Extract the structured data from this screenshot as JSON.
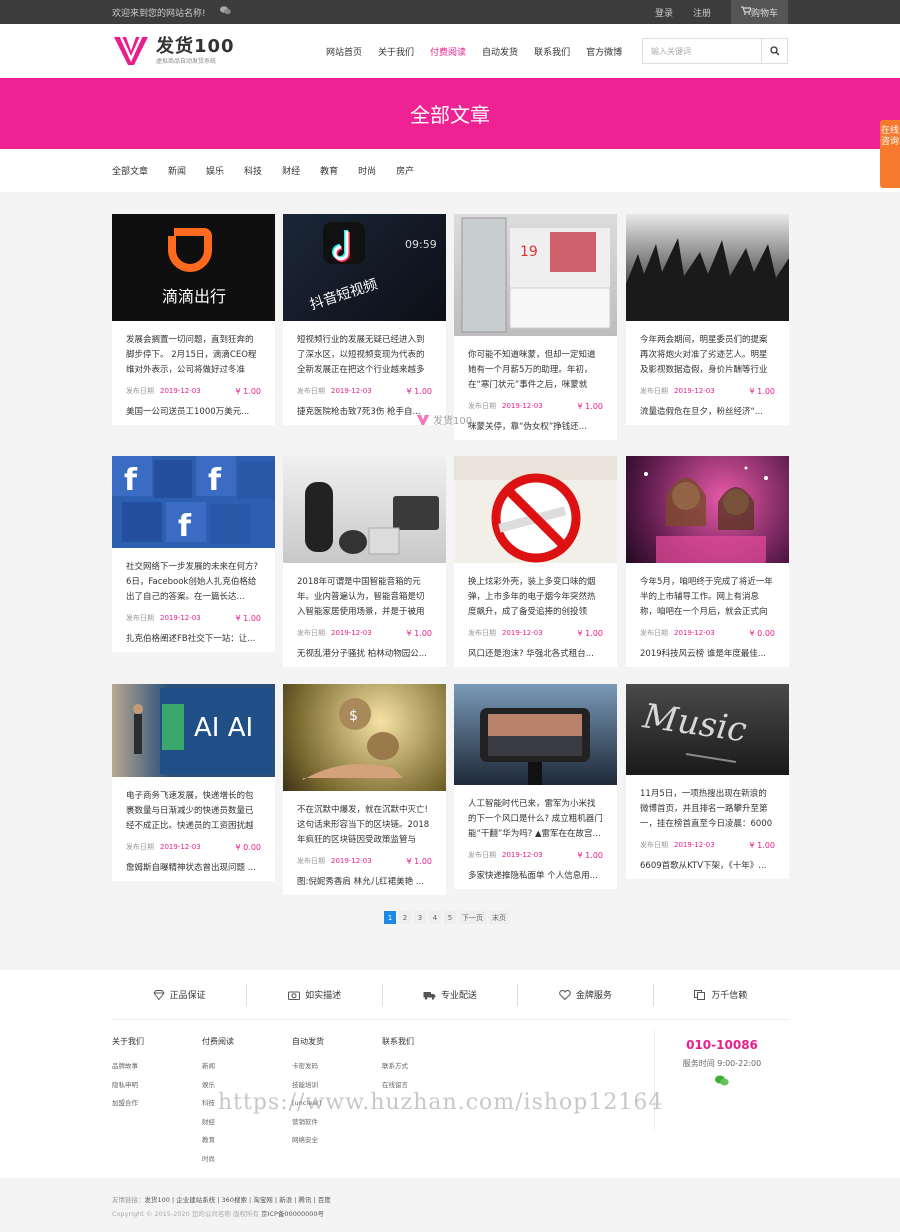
{
  "topbar": {
    "welcome": "欢迎来到您的网站名称!",
    "login": "登录",
    "register": "注册",
    "cart": "购物车"
  },
  "header": {
    "logo_text": "发货100",
    "logo_tagline": "虚拟商品自动发货系统",
    "nav": [
      "网站首页",
      "关于我们",
      "付费阅读",
      "自动发货",
      "联系我们",
      "官方微博"
    ],
    "nav_active_index": 2,
    "search_placeholder": "输入关键词"
  },
  "banner": {
    "title": "全部文章"
  },
  "categories": [
    "全部文章",
    "新闻",
    "娱乐",
    "科技",
    "财经",
    "教育",
    "时尚",
    "房产"
  ],
  "float_consult": "在线咨询",
  "article_meta_label": "发布日期",
  "articles": [
    {
      "excerpt": "发展会搁置一切问题，直到狂奔的脚步停下。 2月15日，滴滴CEO程维对外表示，公司将做好过冬准备，并...",
      "date": "2019-12-03",
      "price": "¥ 1.00",
      "title": "美国一公司送员工1000万美元..."
    },
    {
      "excerpt": "短视频行业的发展无疑已经进入到了深水区，以短视频变现为代表的全新发展正在把这个行业越来越多地放...",
      "date": "2019-12-03",
      "price": "¥ 1.00",
      "title": "捷克医院枪击致7死3伤 枪手自..."
    },
    {
      "excerpt": "你可能不知道咪蒙，但却一定知道她有一个月薪5万的助理。年初，在“寒门状元”事件之后，咪蒙就曾...",
      "date": "2019-12-03",
      "price": "¥ 1.00",
      "title": "咪蒙关停，靠“伪女权”挣钱还..."
    },
    {
      "excerpt": "今年两会期间，明星委员们的提案再次将炮火对准了劣迹艺人。明星及影视数据造假，身价片酬等行业乱象...",
      "date": "2019-12-03",
      "price": "¥ 1.00",
      "title": "流量造假危在旦夕，粉丝经济“..."
    },
    {
      "excerpt": "社交网络下一步发展的未来在何方? 6日，Facebook创始人扎克伯格给出了自己的答案。在一篇长达...",
      "date": "2019-12-03",
      "price": "¥ 1.00",
      "title": "扎克伯格阐述FB社交下一站：让..."
    },
    {
      "excerpt": "2018年可谓是中国智能音箱的元年。业内普遍认为，智能音箱是切入智能家居使用场景，并是于被用户...",
      "date": "2019-12-03",
      "price": "¥ 1.00",
      "title": "无视乱港分子骚扰 柏林动物园公..."
    },
    {
      "excerpt": "换上炫彩外壳，装上多变口味的烟弹，上市多年的电子烟今年突然热度飙升，成了备受追捧的创投领域。...",
      "date": "2019-12-03",
      "price": "¥ 1.00",
      "title": "风口还是泡沫? 华强北各式租台..."
    },
    {
      "excerpt": "今年5月，咱吧终于完成了将近一年半的上市辅导工作。网上有消息称，咱吧在一个月后，就会正式向证监...",
      "date": "2019-12-03",
      "price": "¥ 0.00",
      "title": "2019科技风云榜 谁是年度最佳..."
    },
    {
      "excerpt": "电子商务飞速发展，快递增长的包裹数量与日渐减少的快递员数量已经不成正比。快递员的工资困扰越来越...",
      "date": "2019-12-03",
      "price": "¥ 0.00",
      "title": "詹姆斯自曝精神状态曾出现问题 ..."
    },
    {
      "excerpt": "不在沉默中爆发，就在沉默中灭亡! 这句话来形容当下的区块链。2018年疯狂的区块链因受政策监管与打...",
      "date": "2019-12-03",
      "price": "¥ 1.00",
      "title": "图:倪妮秀香肩 林允儿红裙美艳 ..."
    },
    {
      "excerpt": "人工智能时代已来，雷军为小米找的下一个风口是什么? 成立粗机器门能“干翻”华为吗? ▲雷军在在故宫...",
      "date": "2019-12-03",
      "price": "¥ 1.00",
      "title": "多家快递推隐私面单 个人信息用..."
    },
    {
      "excerpt": "11月5日，一项热搜出现在新浪的微博首页，并且排名一路攀升至第一，挂在榜首直至今日凌晨：6000多音...",
      "date": "2019-12-03",
      "price": "¥ 1.00",
      "title": "6609首歌从KTV下架，《十年》..."
    }
  ],
  "pagination": [
    "1",
    "2",
    "3",
    "4",
    "5",
    "下一页",
    "末页"
  ],
  "guarantees": [
    "正品保证",
    "如实描述",
    "专业配送",
    "金牌服务",
    "万千信赖"
  ],
  "footer_cols": [
    {
      "heading": "关于我们",
      "items": [
        "品牌故事",
        "隐私申明",
        "加盟合作"
      ]
    },
    {
      "heading": "付费阅读",
      "items": [
        "新闻",
        "娱乐",
        "科技",
        "财经",
        "教育",
        "时尚"
      ]
    },
    {
      "heading": "自动发货",
      "items": [
        "卡密发码",
        "技能培训",
        "[unclear]",
        "营销软件",
        "网络安全"
      ]
    },
    {
      "heading": "联系我们",
      "items": [
        "联系方式",
        "在线留言"
      ]
    }
  ],
  "contact": {
    "phone": "010-10086",
    "hours": "服务时间 9:00-22:00"
  },
  "friend_links_label": "友情链接：",
  "friend_links": "发货100 | 企业建站系统 | 360搜索 | 淘宝网 | 新浪 | 腾讯 | 百度",
  "copyright": "Copyright © 2015-2020 您的公司名称 版权所有",
  "icp": "京ICP备00000000号",
  "watermark_center": "发货100",
  "watermark_url": "https://www.huzhan.com/ishop12164",
  "colors": {
    "accent": "#ef2294",
    "pink_text": "#e81e8c",
    "pager_active": "#1e88e5",
    "topbar": "#3c3c3c"
  }
}
